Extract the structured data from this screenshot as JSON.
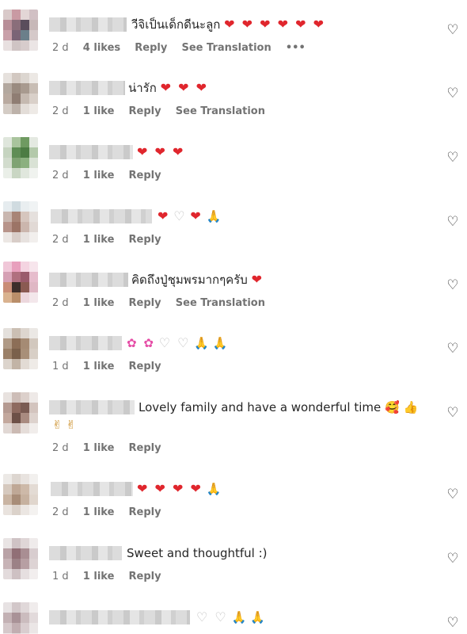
{
  "comments": [
    {
      "text": "วีจิเป็นเด็กดีนะลูก",
      "emoji": "❤ ❤ ❤ ❤ ❤ ❤",
      "time": "2 d",
      "likes": "4 likes",
      "reply": "Reply",
      "translate": "See Translation",
      "more": "•••"
    },
    {
      "text": "น่ารัก",
      "emoji": "❤ ❤ ❤",
      "time": "2 d",
      "likes": "1 like",
      "reply": "Reply",
      "translate": "See Translation"
    },
    {
      "text": "",
      "emoji": "❤ ❤ ❤",
      "time": "2 d",
      "likes": "1 like",
      "reply": "Reply"
    },
    {
      "text": "",
      "emoji_hearts": "❤",
      "emoji_white": "♡",
      "emoji_heart2": "❤",
      "emoji_pray": "🙏",
      "time": "2 d",
      "likes": "1 like",
      "reply": "Reply"
    },
    {
      "text": "คิดถึงปู่ชุมพรมากๆครับ",
      "emoji": "❤",
      "time": "2 d",
      "likes": "1 like",
      "reply": "Reply",
      "translate": "See Translation"
    },
    {
      "text": "",
      "emoji_flowers": "✿ ✿",
      "emoji_white": "♡ ♡",
      "emoji_pray": "🙏 🙏",
      "time": "1 d",
      "likes": "1 like",
      "reply": "Reply"
    },
    {
      "text": "Lovely family and have a wonderful time",
      "emoji_line1": "🥰 👍",
      "emoji_line2": "✌ ✌",
      "time": "2 d",
      "likes": "1 like",
      "reply": "Reply"
    },
    {
      "text": "",
      "emoji": "❤ ❤ ❤ ❤",
      "emoji_pray": "🙏",
      "time": "2 d",
      "likes": "1 like",
      "reply": "Reply"
    },
    {
      "text": "Sweet and thoughtful :)",
      "time": "1 d",
      "likes": "1 like",
      "reply": "Reply"
    },
    {
      "text": "",
      "emoji_white": "♡ ♡",
      "emoji_pray": "🙏 🙏"
    }
  ],
  "icons": {
    "like": "heart-outline-icon",
    "more": "more-options-icon"
  }
}
